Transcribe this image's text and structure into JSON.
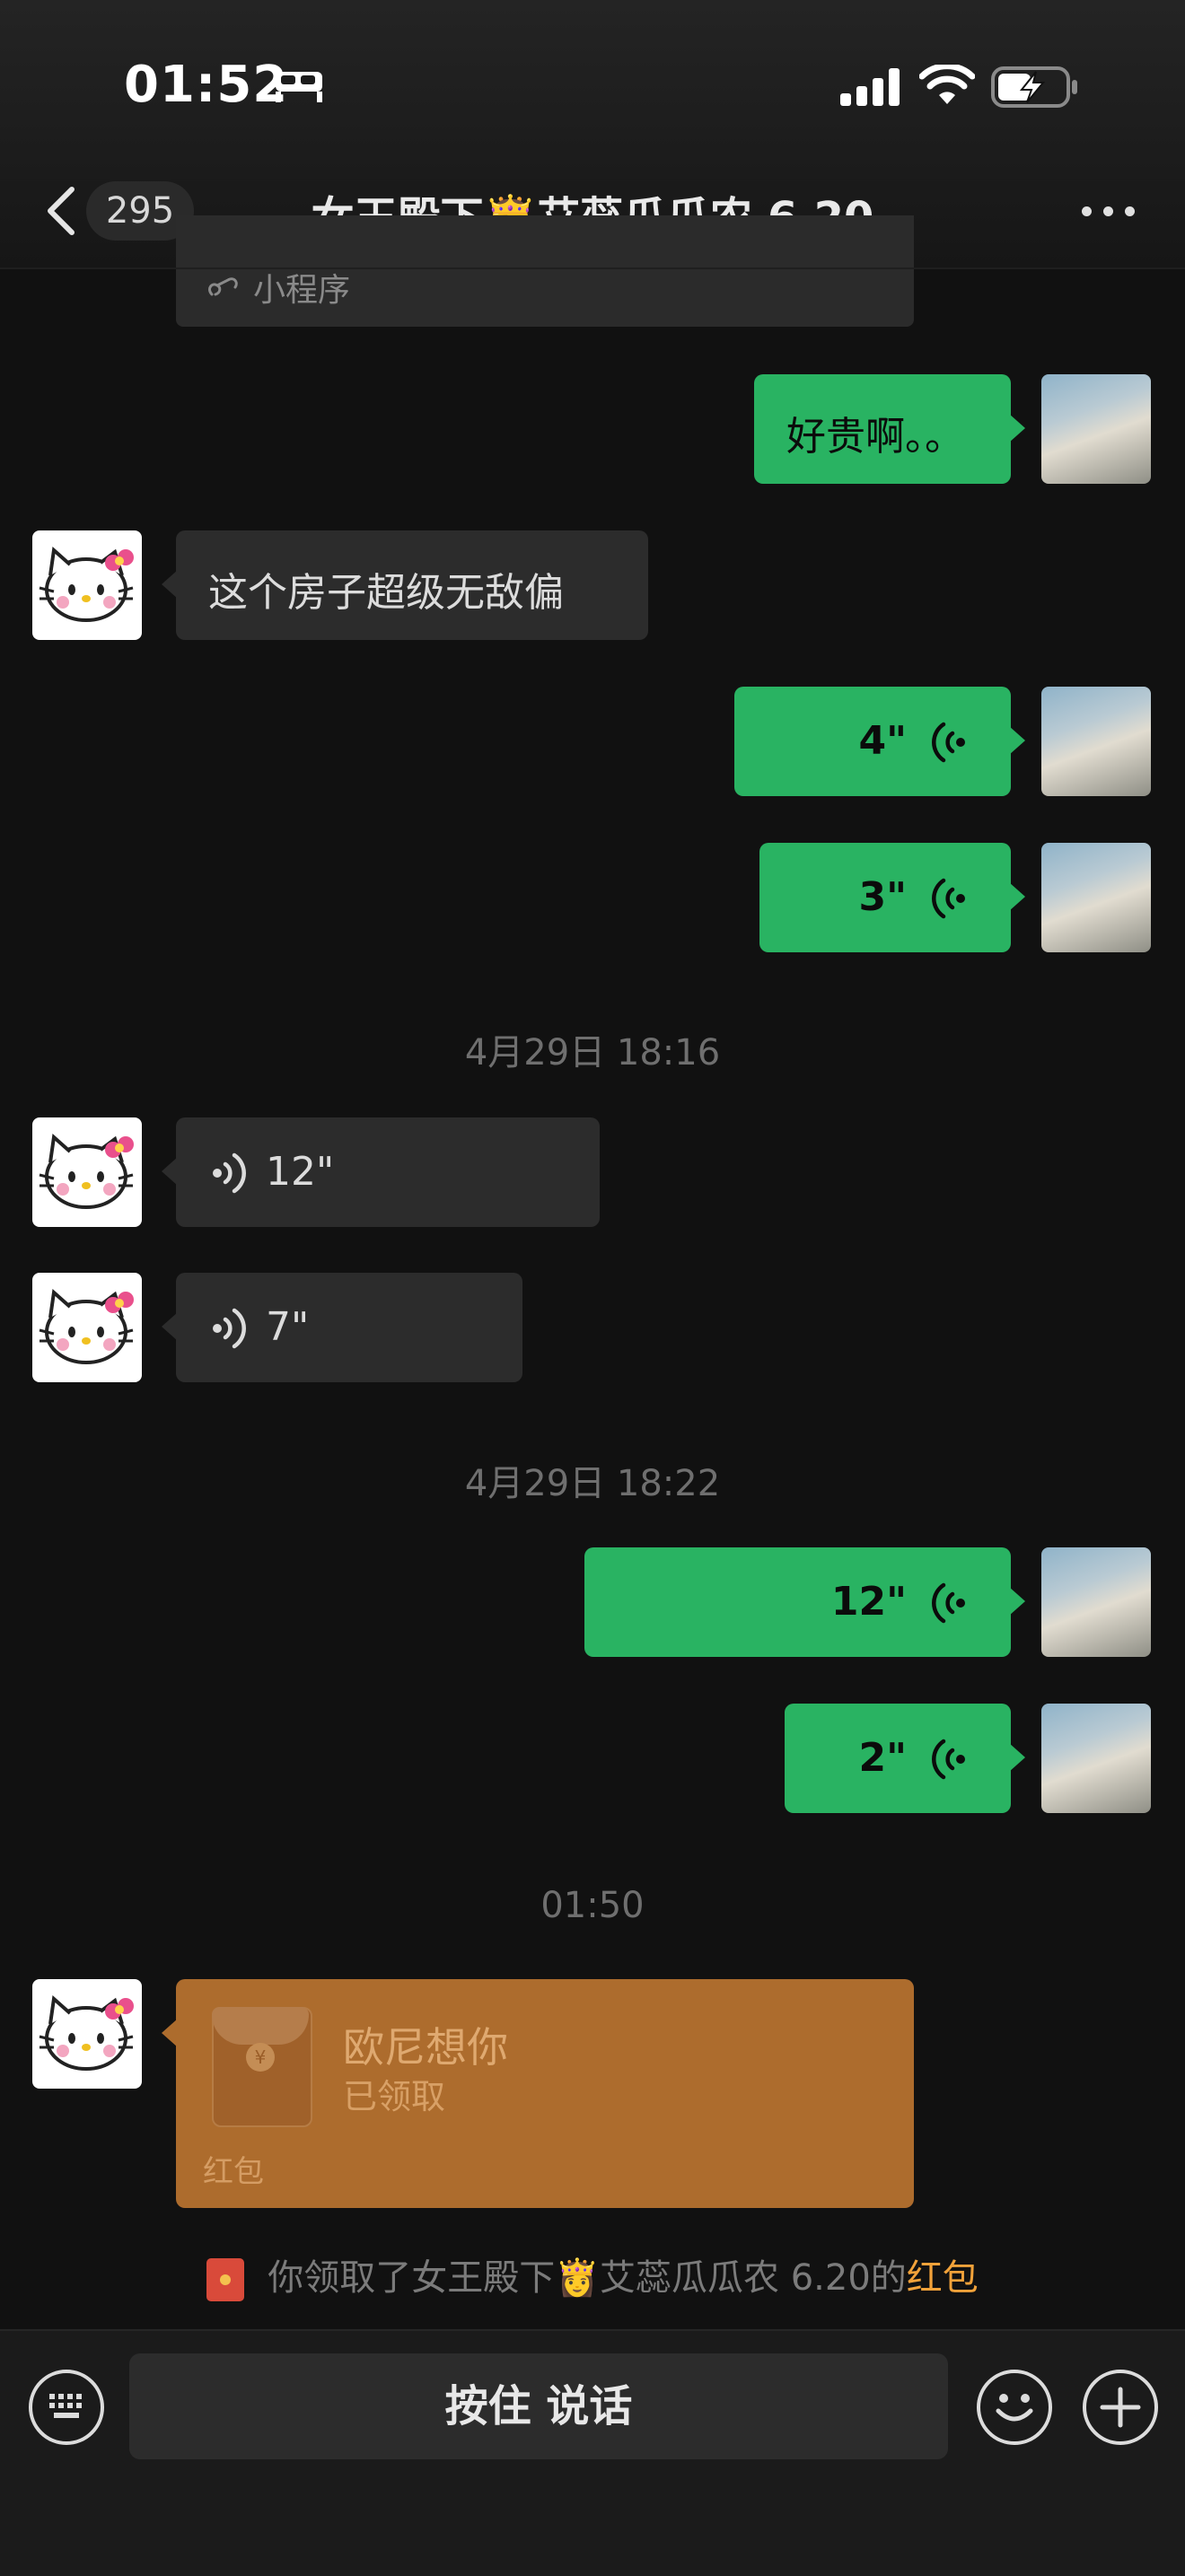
{
  "status_bar": {
    "time": "01:52"
  },
  "nav": {
    "unread_count": "295",
    "title": "女王殿下👸艾蕊瓜瓜农 6.20"
  },
  "partial_card": {
    "label": "小程序"
  },
  "messages": [
    {
      "side": "right",
      "type": "text",
      "text": "好贵啊。。"
    },
    {
      "side": "left",
      "type": "text",
      "text": "这个房子超级无敌偏"
    },
    {
      "side": "right",
      "type": "voice",
      "duration": "4\""
    },
    {
      "side": "right",
      "type": "voice",
      "duration": "3\""
    },
    {
      "type": "timestamp",
      "text": "4月29日 18:16"
    },
    {
      "side": "left",
      "type": "voice",
      "duration": "12\""
    },
    {
      "side": "left",
      "type": "voice",
      "duration": "7\""
    },
    {
      "type": "timestamp",
      "text": "4月29日 18:22"
    },
    {
      "side": "right",
      "type": "voice",
      "duration": "12\""
    },
    {
      "side": "right",
      "type": "voice",
      "duration": "2\""
    },
    {
      "type": "timestamp",
      "text": "01:50"
    }
  ],
  "red_packet": {
    "title": "欧尼想你",
    "status": "已领取",
    "footer": "红包",
    "coin_glyph": "¥"
  },
  "system_notice": {
    "prefix": "你领取了女王殿下👸艾蕊瓜瓜农 6.20的",
    "highlight": "红包"
  },
  "input_bar": {
    "hold_to_talk": "按住 说话"
  },
  "colors": {
    "sent_bubble": "#29b362",
    "received_bubble": "#2c2c2c",
    "red_packet": "#ad6c2d",
    "highlight": "#f2a23a"
  }
}
